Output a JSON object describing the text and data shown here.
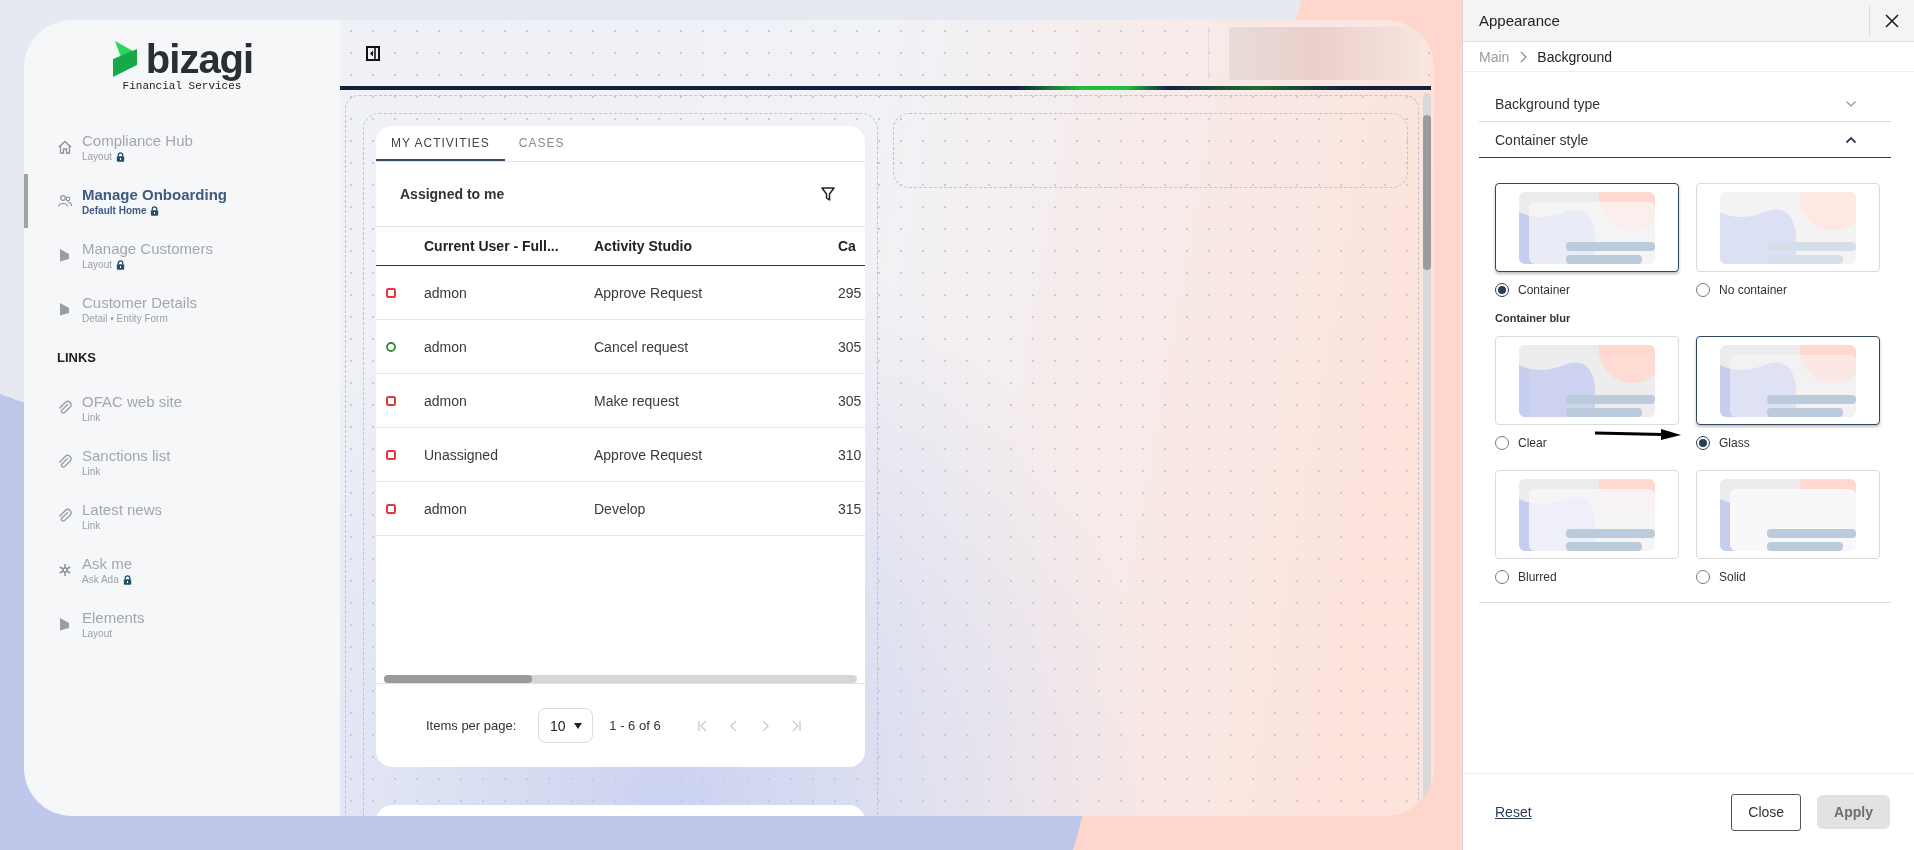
{
  "sidebar": {
    "logo": {
      "wordmark": "bizagi",
      "subtitle": "Financial Services"
    },
    "items": [
      {
        "kind": "home",
        "title": "Compliance Hub",
        "subtitle": "Layout",
        "locked": true,
        "selected": false
      },
      {
        "kind": "people",
        "title": "Manage Onboarding",
        "subtitle": "Default Home",
        "locked": true,
        "selected": true
      },
      {
        "kind": "process",
        "title": "Manage Customers",
        "subtitle": "Layout",
        "locked": true,
        "selected": false
      },
      {
        "kind": "process",
        "title": "Customer Details",
        "subtitle": "Detail • Entity Form",
        "locked": false,
        "selected": false
      }
    ],
    "links_heading": "LINKS",
    "links": [
      {
        "kind": "link",
        "title": "OFAC web site",
        "subtitle": "Link",
        "locked": false,
        "selected": false
      },
      {
        "kind": "link",
        "title": "Sanctions list",
        "subtitle": "Link",
        "locked": false,
        "selected": false
      },
      {
        "kind": "link",
        "title": "Latest news",
        "subtitle": "Link",
        "locked": false,
        "selected": false
      },
      {
        "kind": "assistant",
        "title": "Ask me",
        "subtitle": "Ask Ada",
        "locked": true,
        "selected": false
      },
      {
        "kind": "process",
        "title": "Elements",
        "subtitle": "Layout",
        "locked": false,
        "selected": false
      }
    ]
  },
  "activities": {
    "tabs": [
      {
        "label": "MY ACTIVITIES",
        "selected": true
      },
      {
        "label": "CASES",
        "selected": false
      }
    ],
    "title": "Assigned to me",
    "columns": [
      "Current User - Full...",
      "Activity Studio",
      "Ca"
    ],
    "rows": [
      {
        "kind": "square",
        "color": "#e0393e",
        "cells": [
          "admon",
          "Approve Request",
          "295"
        ]
      },
      {
        "kind": "circle",
        "color": "#2e8b2e",
        "cells": [
          "admon",
          "Cancel request",
          "305"
        ]
      },
      {
        "kind": "square",
        "color": "#e0393e",
        "cells": [
          "admon",
          "Make request",
          "305"
        ]
      },
      {
        "kind": "square",
        "color": "#e0393e",
        "cells": [
          "Unassigned",
          "Approve Request",
          "310"
        ]
      },
      {
        "kind": "square",
        "color": "#e0393e",
        "cells": [
          "admon",
          "Develop",
          "315"
        ]
      }
    ],
    "pagination": {
      "label": "Items per page:",
      "page_size": "10",
      "range": "1 - 6 of 6",
      "buttons": [
        {
          "kind": "first",
          "disabled": true
        },
        {
          "kind": "prev",
          "disabled": true
        },
        {
          "kind": "next",
          "disabled": true
        },
        {
          "kind": "last",
          "disabled": true
        }
      ]
    }
  },
  "appearance": {
    "title": "Appearance",
    "breadcrumb": [
      "Main",
      "Background"
    ],
    "sections": [
      {
        "label": "Background type",
        "expanded": false
      },
      {
        "label": "Container style",
        "expanded": true
      }
    ],
    "style_options": [
      {
        "kind": "container",
        "label": "Container",
        "selected": true
      },
      {
        "kind": "none",
        "label": "No container",
        "selected": false
      }
    ],
    "blur_label": "Container blur",
    "blur_options": [
      {
        "kind": "clear",
        "label": "Clear",
        "selected": false
      },
      {
        "kind": "glass",
        "label": "Glass",
        "selected": true
      },
      {
        "kind": "blurred",
        "label": "Blurred",
        "selected": false
      },
      {
        "kind": "solid",
        "label": "Solid",
        "selected": false
      }
    ],
    "footer": {
      "reset": "Reset",
      "buttons": [
        {
          "label": "Close",
          "disabled": false
        },
        {
          "label": "Apply",
          "disabled": true
        }
      ]
    }
  }
}
